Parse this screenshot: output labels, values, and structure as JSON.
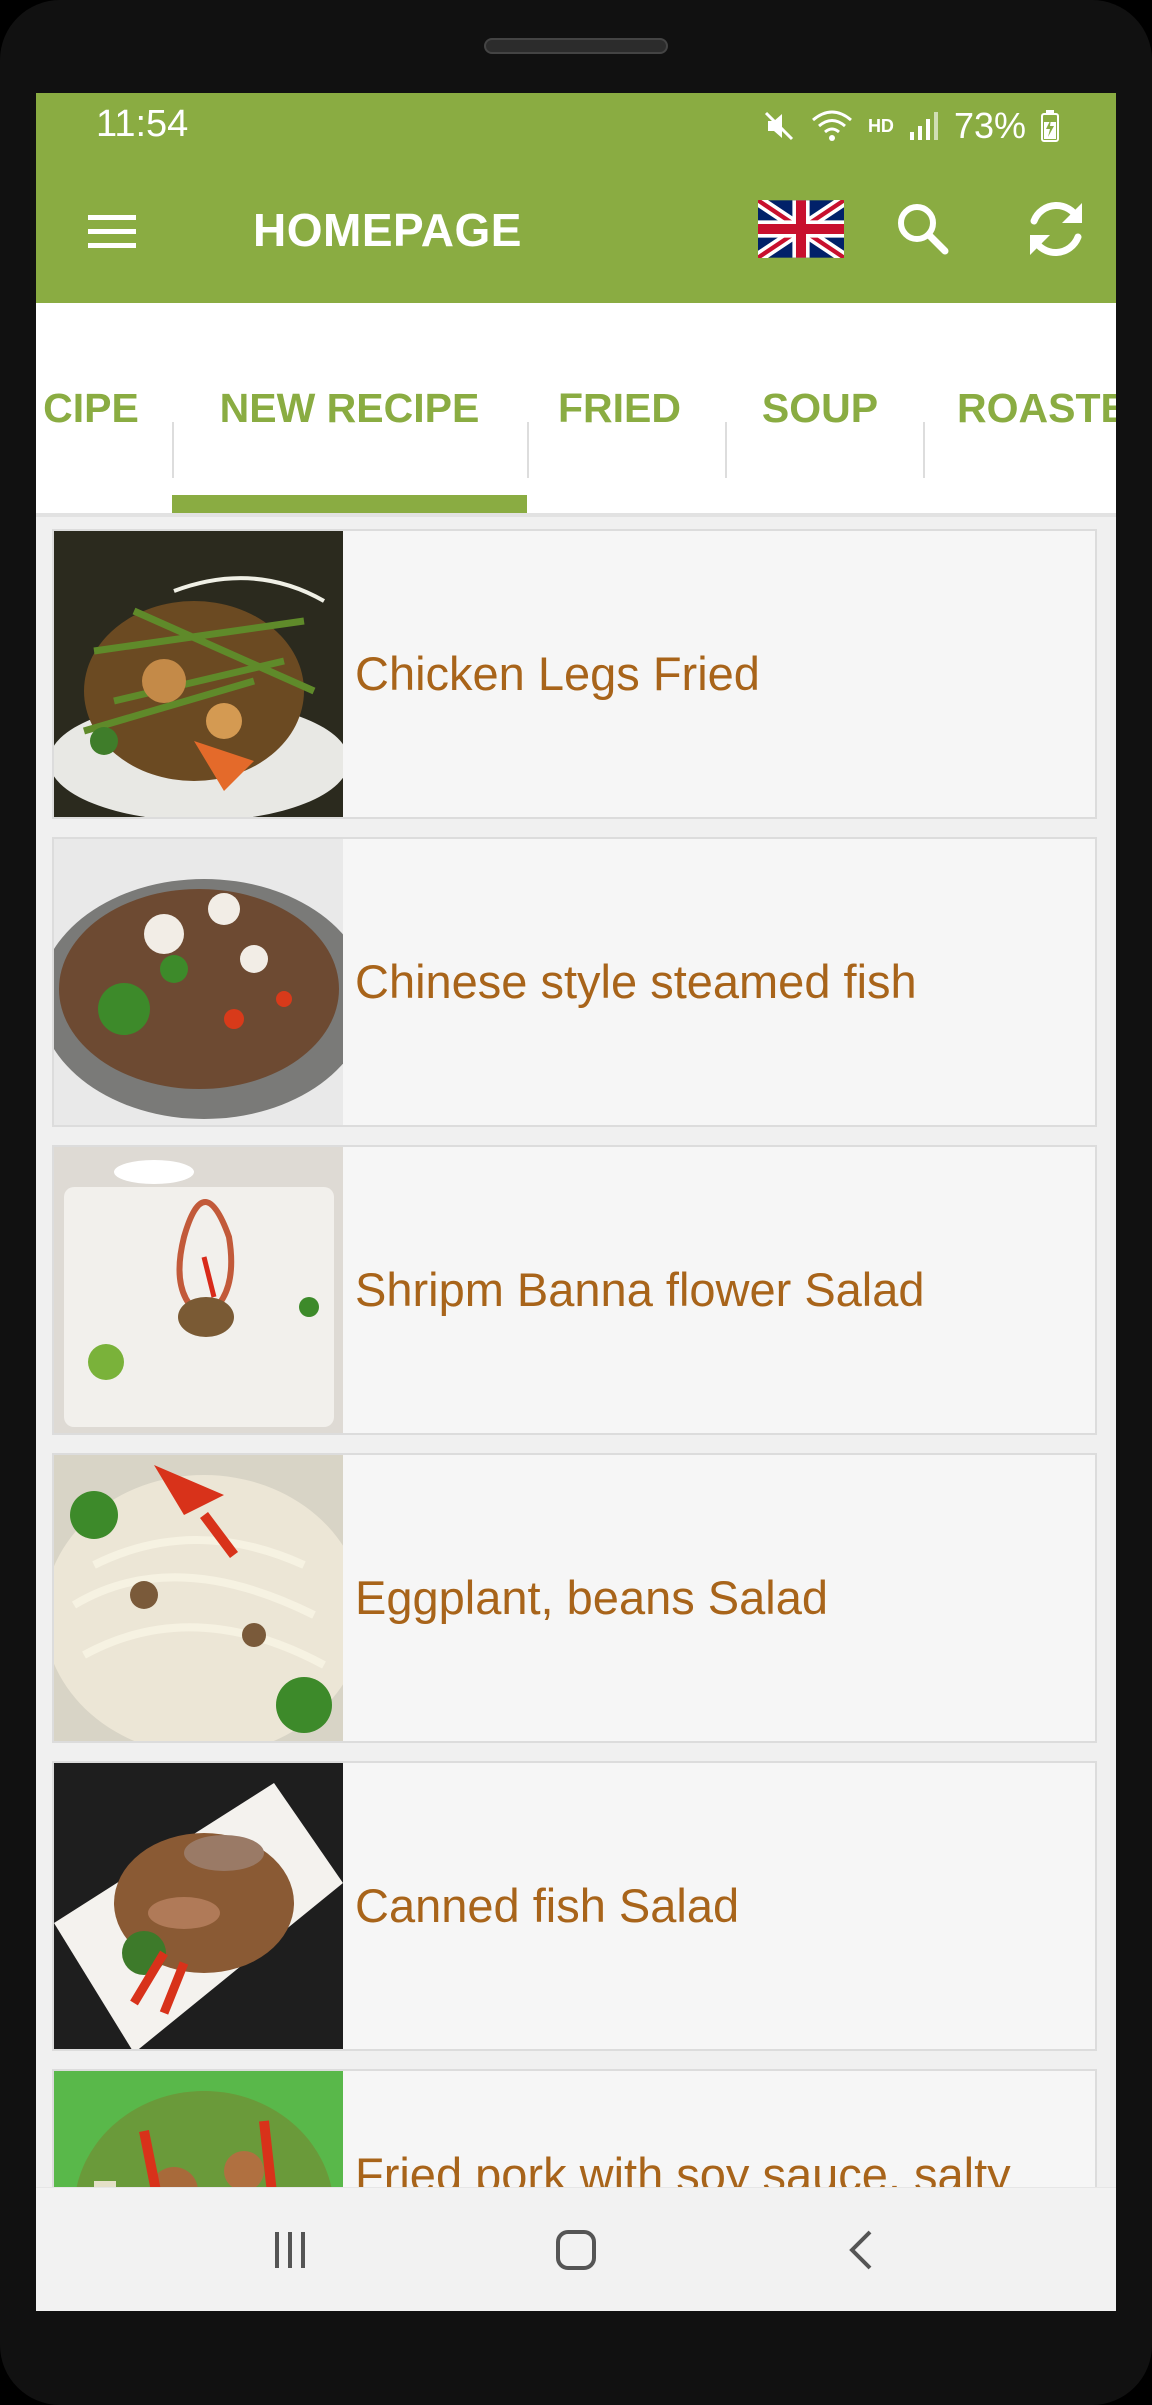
{
  "status_bar": {
    "time": "11:54",
    "battery": "73%",
    "network_label": "HD",
    "icons": [
      "mute-icon",
      "wifi-icon",
      "signal-icon",
      "battery-icon"
    ]
  },
  "toolbar": {
    "title": "HOMEPAGE",
    "menu_icon": "hamburger-menu-icon",
    "language_icon": "uk-flag-icon",
    "search_icon": "search-icon",
    "refresh_icon": "refresh-icon"
  },
  "tabs": [
    {
      "label": "CIPE",
      "selected": false
    },
    {
      "label": "NEW RECIPE",
      "selected": true
    },
    {
      "label": "FRIED",
      "selected": false
    },
    {
      "label": "SOUP",
      "selected": false
    },
    {
      "label": "ROASTE",
      "selected": false
    }
  ],
  "recipes": [
    {
      "title": "Chicken Legs Fried",
      "image": "fried-chicken-legs-dish"
    },
    {
      "title": "Chinese style steamed fish",
      "image": "steamed-fish-dish"
    },
    {
      "title": "Shripm Banna flower Salad",
      "image": "banana-flower-salad-dish"
    },
    {
      "title": "Eggplant, beans Salad",
      "image": "eggplant-beans-salad-dish"
    },
    {
      "title": "Canned fish Salad",
      "image": "canned-fish-salad-dish"
    },
    {
      "title": "Fried pork with soy sauce, salty and sour taste",
      "image": "fried-pork-soy-sauce-dish"
    }
  ],
  "nav_bar": {
    "recents_icon": "recents-icon",
    "home_icon": "home-icon",
    "back_icon": "back-icon"
  },
  "colors": {
    "accent": "#8aac42",
    "recipe_title": "#a8641a",
    "card_background": "#f6f6f6"
  }
}
